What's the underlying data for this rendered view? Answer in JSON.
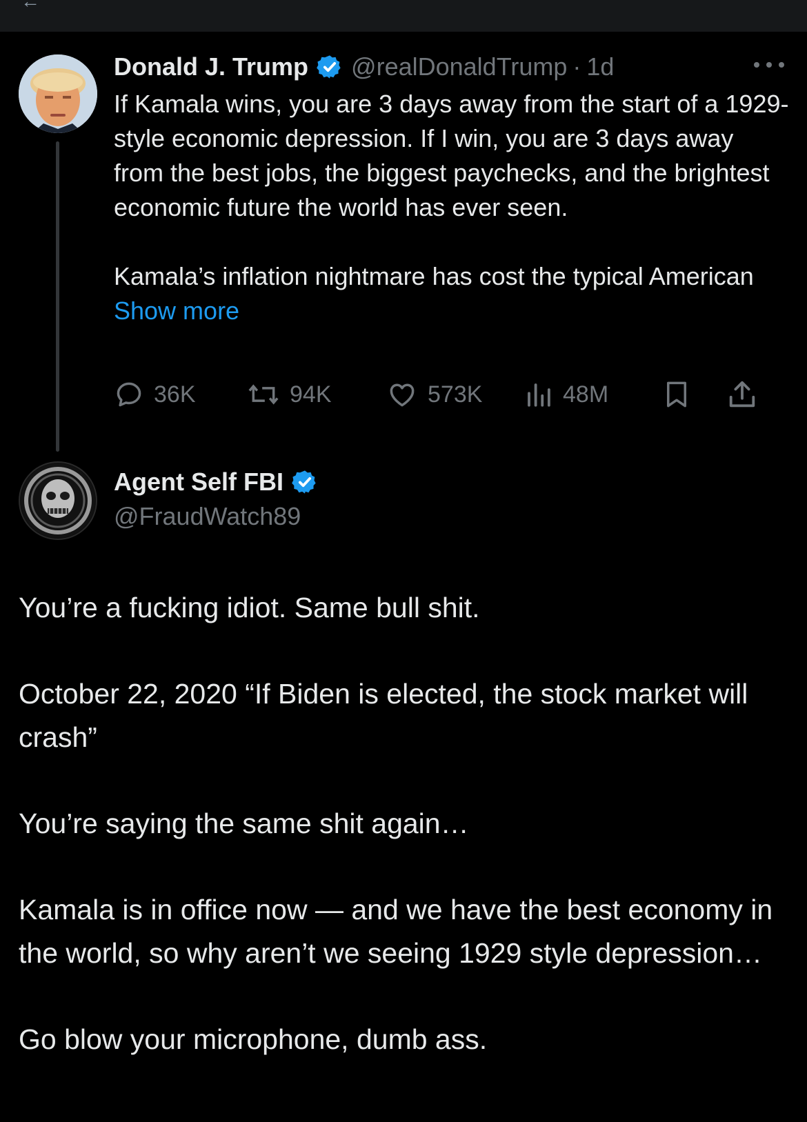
{
  "colors": {
    "background": "#000000",
    "text": "#e7e9ea",
    "muted": "#71767b",
    "accent": "#1d9bf0",
    "verified": "#1d9bf0"
  },
  "parent_tweet": {
    "author_name": "Donald J. Trump",
    "handle": "@realDonaldTrump",
    "separator": "·",
    "time": "1d",
    "paragraph1": "If Kamala wins, you are 3 days away from the start of a 1929-style economic depression. If I win, you are 3 days away from the best jobs, the biggest paychecks, and the brightest economic future the world has ever seen.",
    "paragraph2": "Kamala’s inflation nightmare has cost the typical American",
    "show_more": "Show more",
    "replies": "36K",
    "reposts": "94K",
    "likes": "573K",
    "views": "48M",
    "icons": [
      "reply-icon",
      "repost-icon",
      "like-icon",
      "views-icon",
      "bookmark-icon",
      "share-icon",
      "more-icon",
      "verified-badge-icon"
    ]
  },
  "reply": {
    "author_name": "Agent Self FBI",
    "handle": "@FraudWatch89",
    "paragraphs": [
      "You’re a fucking idiot. Same bull shit.",
      "October 22, 2020 “If Biden is elected, the stock market will crash”",
      "You’re saying the same shit again…",
      "Kamala is in office now — and we have the best economy in the world, so why aren’t we seeing 1929 style depression…",
      "Go blow your microphone, dumb ass."
    ]
  }
}
